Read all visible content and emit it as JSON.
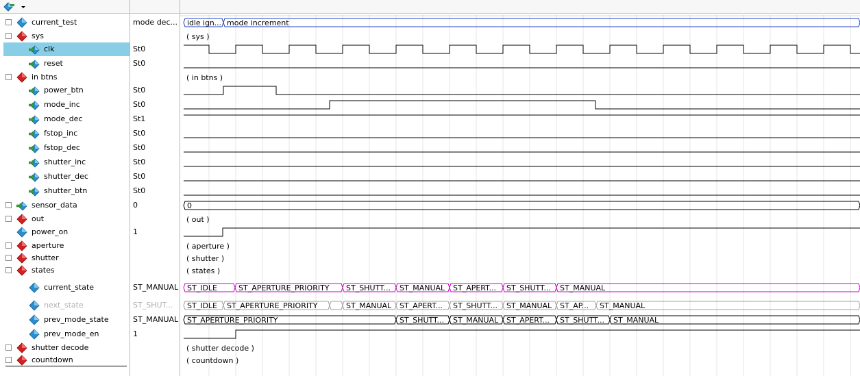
{
  "toolbar": {
    "dropdown_icon": "signal-add-icon"
  },
  "signals": [
    {
      "id": "current_test",
      "label": "current_test",
      "value": "mode dec...",
      "expander": "+",
      "icon": "blue",
      "indent": 0
    },
    {
      "id": "sys",
      "label": "sys",
      "value": "",
      "expander": "-",
      "icon": "red",
      "indent": 0
    },
    {
      "id": "clk",
      "label": "clk",
      "value": "St0",
      "expander": "",
      "icon": "clock",
      "indent": 1,
      "selected": true
    },
    {
      "id": "reset",
      "label": "reset",
      "value": "St0",
      "expander": "",
      "icon": "input",
      "indent": 1
    },
    {
      "id": "in_btns",
      "label": "in btns",
      "value": "",
      "expander": "-",
      "icon": "red",
      "indent": 0
    },
    {
      "id": "power_btn",
      "label": "power_btn",
      "value": "St0",
      "expander": "",
      "icon": "input",
      "indent": 1
    },
    {
      "id": "mode_inc",
      "label": "mode_inc",
      "value": "St0",
      "expander": "",
      "icon": "input",
      "indent": 1
    },
    {
      "id": "mode_dec",
      "label": "mode_dec",
      "value": "St1",
      "expander": "",
      "icon": "input",
      "indent": 1
    },
    {
      "id": "fstop_inc",
      "label": "fstop_inc",
      "value": "St0",
      "expander": "",
      "icon": "input",
      "indent": 1
    },
    {
      "id": "fstop_dec",
      "label": "fstop_dec",
      "value": "St0",
      "expander": "",
      "icon": "input",
      "indent": 1
    },
    {
      "id": "shutter_inc",
      "label": "shutter_inc",
      "value": "St0",
      "expander": "",
      "icon": "input",
      "indent": 1
    },
    {
      "id": "shutter_dec",
      "label": "shutter_dec",
      "value": "St0",
      "expander": "",
      "icon": "input",
      "indent": 1
    },
    {
      "id": "shutter_btn",
      "label": "shutter_btn",
      "value": "St0",
      "expander": "",
      "icon": "input",
      "indent": 1
    },
    {
      "id": "sensor_data",
      "label": "sensor_data",
      "value": "0",
      "expander": "+",
      "icon": "input",
      "indent": 0
    },
    {
      "id": "out",
      "label": "out",
      "value": "",
      "expander": "+",
      "icon": "red",
      "indent": 0
    },
    {
      "id": "power_on",
      "label": "power_on",
      "value": "1",
      "expander": "",
      "icon": "blue",
      "indent": 0
    },
    {
      "id": "aperture",
      "label": "aperture",
      "value": "",
      "expander": "+",
      "icon": "red",
      "indent": 0
    },
    {
      "id": "shutter",
      "label": "shutter",
      "value": "",
      "expander": "+",
      "icon": "red",
      "indent": 0
    },
    {
      "id": "states",
      "label": "states",
      "value": "",
      "expander": "-",
      "icon": "red",
      "indent": 0
    },
    {
      "id": "current_state",
      "label": "current_state",
      "value": "ST_MANUAL",
      "expander": "",
      "icon": "blue",
      "indent": 1
    },
    {
      "id": "next_state",
      "label": "next_state",
      "value": "ST_SHUT...",
      "expander": "",
      "icon": "blue",
      "indent": 1,
      "dim": true
    },
    {
      "id": "prev_mode_state",
      "label": "prev_mode_state",
      "value": "ST_MANUAL",
      "expander": "",
      "icon": "blue",
      "indent": 1
    },
    {
      "id": "prev_mode_en",
      "label": "prev_mode_en",
      "value": "1",
      "expander": "",
      "icon": "blue",
      "indent": 1
    },
    {
      "id": "shutter_decode",
      "label": "shutter decode",
      "value": "",
      "expander": "+",
      "icon": "red",
      "indent": 0
    },
    {
      "id": "countdown",
      "label": "countdown",
      "value": "",
      "expander": "+",
      "icon": "red",
      "indent": 0
    }
  ],
  "waves": {
    "current_test": {
      "kind": "bus",
      "color": "#2040c0",
      "segments": [
        {
          "label": "idle ign..."
        },
        {
          "label": "mode increment"
        }
      ]
    },
    "sys": {
      "kind": "group",
      "label": "( sys )"
    },
    "clk": {
      "kind": "clock"
    },
    "reset": {
      "kind": "bit",
      "color": "#000000",
      "levels": [
        0
      ]
    },
    "in_btns": {
      "kind": "group",
      "label": "( in btns )"
    },
    "power_btn": {
      "kind": "bit",
      "color": "#000000",
      "levels": [
        0,
        1,
        0
      ]
    },
    "mode_inc": {
      "kind": "bit",
      "color": "#000000",
      "levels": [
        0,
        1,
        0
      ]
    },
    "mode_dec": {
      "kind": "bit",
      "color": "#000000",
      "levels": [
        1
      ]
    },
    "fstop_inc": {
      "kind": "bit",
      "color": "#000000",
      "levels": [
        0
      ]
    },
    "fstop_dec": {
      "kind": "bit",
      "color": "#000000",
      "levels": [
        0
      ]
    },
    "shutter_inc": {
      "kind": "bit",
      "color": "#000000",
      "levels": [
        0
      ]
    },
    "shutter_dec": {
      "kind": "bit",
      "color": "#000000",
      "levels": [
        0
      ]
    },
    "shutter_btn": {
      "kind": "bit",
      "color": "#000000",
      "levels": [
        0
      ]
    },
    "sensor_data": {
      "kind": "bus",
      "color": "#000000",
      "segments": [
        {
          "label": "0"
        }
      ]
    },
    "out": {
      "kind": "group",
      "label": "( out )"
    },
    "power_on": {
      "kind": "bit",
      "color": "#000000",
      "levels": [
        0,
        1
      ]
    },
    "aperture": {
      "kind": "group",
      "label": "( aperture )"
    },
    "shutter": {
      "kind": "group",
      "label": "( shutter )"
    },
    "states": {
      "kind": "group",
      "label": "( states )"
    },
    "current_state": {
      "kind": "bus",
      "color": "#cc00cc",
      "segments": [
        {
          "label": "ST_IDLE"
        },
        {
          "label": "ST_APERTURE_PRIORITY"
        },
        {
          "label": "ST_SHUTT..."
        },
        {
          "label": "ST_MANUAL"
        },
        {
          "label": "ST_APERT..."
        },
        {
          "label": "ST_SHUTT..."
        },
        {
          "label": "ST_MANUAL"
        }
      ]
    },
    "next_state": {
      "kind": "bus",
      "color": "#a0a0a0",
      "segments": [
        {
          "label": "ST_IDLE"
        },
        {
          "label": "ST_APERTURE_PRIORITY"
        },
        {
          "label": ""
        },
        {
          "label": "ST_MANUAL"
        },
        {
          "label": "ST_APERT..."
        },
        {
          "label": "ST_SHUTT..."
        },
        {
          "label": "ST_MANUAL"
        },
        {
          "label": "ST_AP..."
        },
        {
          "label": "ST_MANUAL"
        }
      ]
    },
    "prev_mode_state": {
      "kind": "bus",
      "color": "#000000",
      "segments": [
        {
          "label": "ST_APERTURE_PRIORITY"
        },
        {
          "label": "ST_SHUTT..."
        },
        {
          "label": "ST_MANUAL"
        },
        {
          "label": "ST_APERT..."
        },
        {
          "label": "ST_SHUTT..."
        },
        {
          "label": "ST_MANUAL"
        }
      ]
    },
    "prev_mode_en": {
      "kind": "bit",
      "color": "#000000",
      "levels": [
        0,
        1
      ]
    },
    "shutter_decode": {
      "kind": "group",
      "label": "( shutter decode )"
    },
    "countdown": {
      "kind": "group",
      "label": "( countdown )"
    }
  }
}
